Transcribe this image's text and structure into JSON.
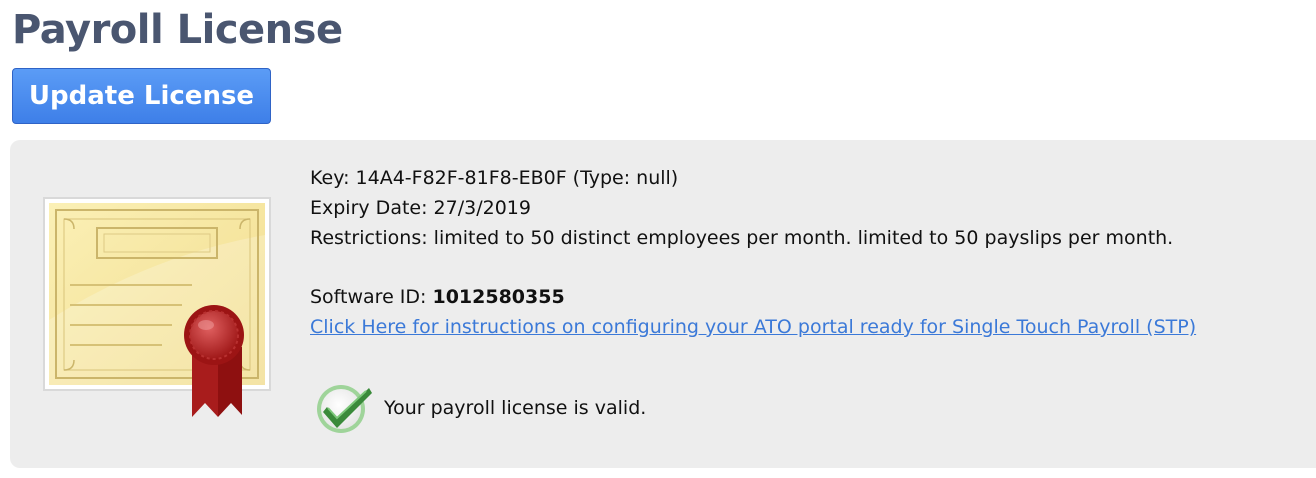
{
  "page": {
    "title": "Payroll License"
  },
  "toolbar": {
    "update_label": "Update License"
  },
  "license": {
    "key_prefix": "Key: ",
    "key_value": "14A4-F82F-81F8-EB0F (Type: null)",
    "expiry_prefix": "Expiry Date: ",
    "expiry_value": "27/3/2019",
    "restrictions_prefix": "Restrictions: ",
    "restrictions_value": "limited to 50 distinct employees per month. limited to 50 payslips per month.",
    "software_id_prefix": "Software ID: ",
    "software_id_value": "1012580355",
    "stp_link_text": "Click Here for instructions on configuring your ATO portal ready for Single Touch Payroll (STP)",
    "status_text": "Your payroll license is valid."
  },
  "icons": {
    "certificate": "certificate-icon",
    "status": "check-circle-icon"
  },
  "colors": {
    "title": "#4a5670",
    "button": "#3e7fe8",
    "link": "#3b79d8",
    "panel": "#ededed",
    "check": "#3a8a3a"
  }
}
